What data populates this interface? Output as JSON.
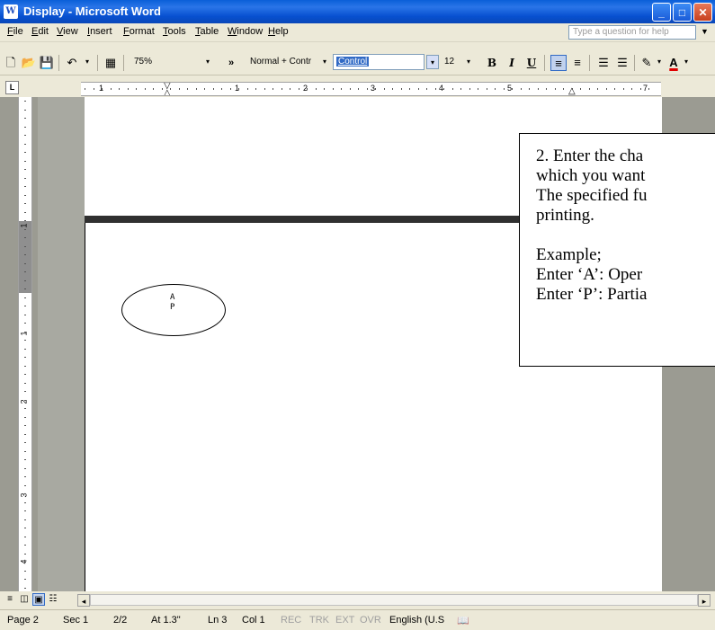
{
  "window": {
    "title": "Display - Microsoft Word",
    "app_icon": "word-icon",
    "minimize": "‗",
    "maximize": "□",
    "close": "✕"
  },
  "menu": {
    "items": [
      "File",
      "Edit",
      "View",
      "Insert",
      "Format",
      "Tools",
      "Table",
      "Window",
      "Help"
    ],
    "help_placeholder": "Type a question for help"
  },
  "toolbar": {
    "zoom": "75%",
    "style": "Normal + Contr",
    "font": "Control",
    "font_size": "12",
    "bold": "B",
    "italic": "I",
    "underline": "U",
    "more": "»"
  },
  "ruler": {
    "corner": "L",
    "h_numbers": [
      "1",
      "1",
      "2",
      "3",
      "4",
      "5",
      "7"
    ],
    "v_numbers": [
      "1",
      "1",
      "2",
      "3",
      "4"
    ]
  },
  "document": {
    "ellipse_lines": [
      "A",
      "P"
    ],
    "callout_lines": [
      "2. Enter the cha",
      "which you want",
      "The specified fu",
      "printing.",
      "",
      "Example;",
      "Enter ‘A’: Oper",
      "Enter ‘P’: Partia"
    ]
  },
  "statusbar": {
    "page": "Page 2",
    "sec": "Sec 1",
    "pages": "2/2",
    "at": "At 1.3\"",
    "ln": "Ln 3",
    "col": "Col 1",
    "rec": "REC",
    "trk": "TRK",
    "ext": "EXT",
    "ovr": "OVR",
    "language": "English (U.S"
  },
  "colors": {
    "titlebar": "#0A5FD8",
    "chrome": "#ECE9D8",
    "workspace": "#9B9B92"
  }
}
